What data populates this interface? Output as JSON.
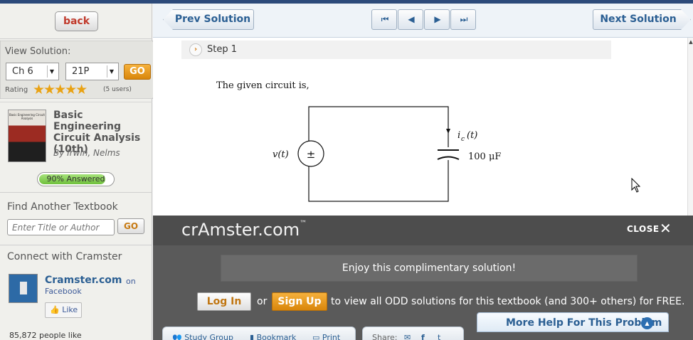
{
  "sidebar": {
    "back_label": "back",
    "view_solution": {
      "title": "View Solution:",
      "chapter": "Ch 6",
      "problem": "21P",
      "go_label": "GO",
      "rating_label": "Rating",
      "stars": "★★★★★",
      "rating_value": 4.5,
      "rating_count": "(5 users)"
    },
    "book": {
      "cover_text": "Basic Engineering Circuit Analysis",
      "title": "Basic Engineering Circuit Analysis (10th)",
      "author": "By Irwin, Nelms",
      "answered_text": "90% Answered",
      "answered_fraction": 0.9
    },
    "find": {
      "title": "Find Another Textbook",
      "placeholder": "Enter Title or Author",
      "go_label": "GO"
    },
    "connect": {
      "title": "Connect with Cramster",
      "page_name": "Cramster.com",
      "on_text": "on",
      "network": "Facebook",
      "like_label": "Like",
      "people_like": "85,872 people like"
    }
  },
  "topnav": {
    "prev_label": "Prev Solution",
    "next_label": "Next Solution",
    "first_icon": "⏮",
    "prev_icon": "◀",
    "next_icon": "▶",
    "last_icon": "⏭"
  },
  "content": {
    "step_label": "Step 1",
    "step_icon": "›",
    "given_text": "The given circuit is,",
    "circuit": {
      "source_label": "v(t)",
      "source_symbol": "±",
      "current_label": "i",
      "current_sub": "c",
      "current_arg": "(t)",
      "capacitor_label": "100 μF"
    }
  },
  "overlay": {
    "logo": "crAmster.com",
    "logo_tm": "™",
    "close_label": "CLOSE",
    "close_icon": "✕",
    "enjoy_text": "Enjoy this complimentary solution!",
    "login_label": "Log In",
    "or_text": "or",
    "signup_label": "Sign Up",
    "promo_text": "to view all ODD solutions for this textbook (and 300+ others) for FREE."
  },
  "bottom": {
    "study_group": "Study Group",
    "bookmark": "Bookmark",
    "print": "Print",
    "share": "Share:",
    "more_help": "More Help For This Problem",
    "more_help_icon": "▲"
  }
}
